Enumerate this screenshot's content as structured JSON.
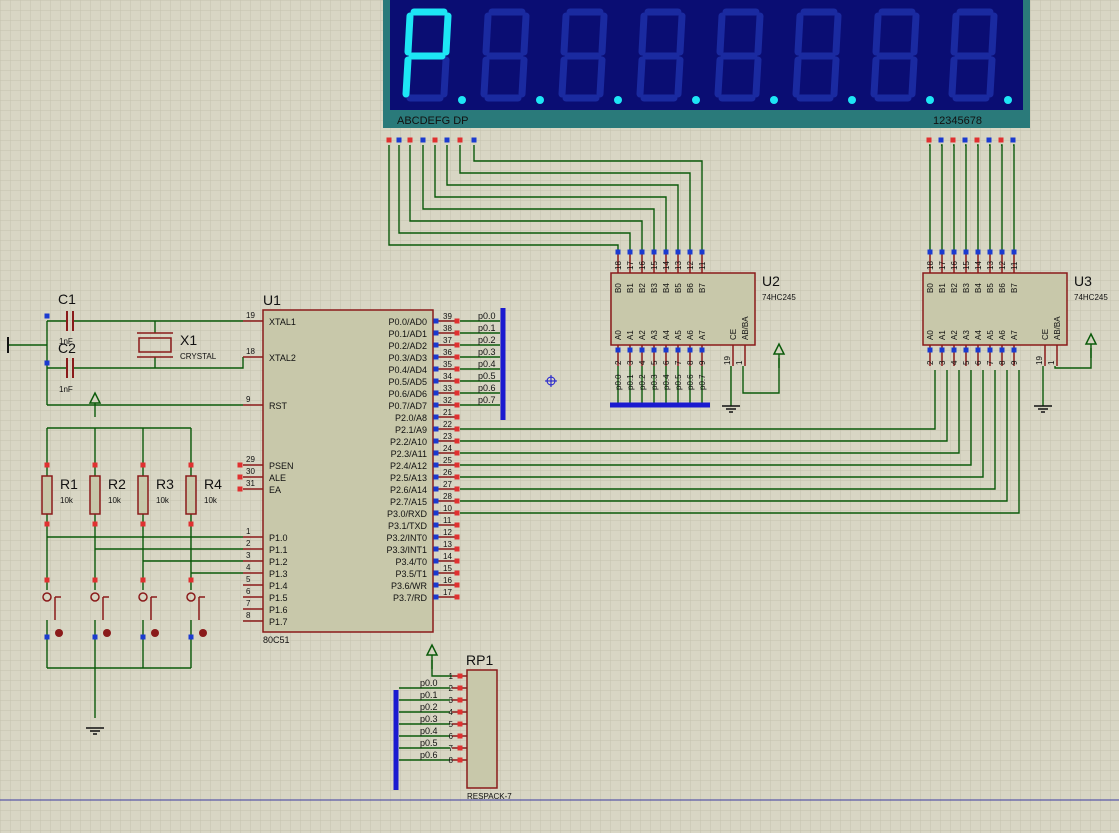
{
  "display": {
    "digit_text": "P",
    "seg_label": "ABCDEFG DP",
    "dig_label": "12345678",
    "colors": {
      "frame": "#2a7a7a",
      "background": "#0a0d73",
      "segment_on": "#1de6f5",
      "segment_off": "#1a2aa0"
    }
  },
  "u1": {
    "ref": "U1",
    "part": "80C51",
    "left_pins": [
      {
        "num": "19",
        "name": "XTAL1"
      },
      {
        "num": "18",
        "name": "XTAL2"
      },
      {
        "num": "9",
        "name": "RST"
      },
      {
        "num": "29",
        "name": "PSEN"
      },
      {
        "num": "30",
        "name": "ALE"
      },
      {
        "num": "31",
        "name": "EA"
      },
      {
        "num": "1",
        "name": "P1.0"
      },
      {
        "num": "2",
        "name": "P1.1"
      },
      {
        "num": "3",
        "name": "P1.2"
      },
      {
        "num": "4",
        "name": "P1.3"
      },
      {
        "num": "5",
        "name": "P1.4"
      },
      {
        "num": "6",
        "name": "P1.5"
      },
      {
        "num": "7",
        "name": "P1.6"
      },
      {
        "num": "8",
        "name": "P1.7"
      }
    ],
    "right_pins": [
      {
        "num": "39",
        "name": "P0.0/AD0",
        "net": "p0.0"
      },
      {
        "num": "38",
        "name": "P0.1/AD1",
        "net": "p0.1"
      },
      {
        "num": "37",
        "name": "P0.2/AD2",
        "net": "p0.2"
      },
      {
        "num": "36",
        "name": "P0.3/AD3",
        "net": "p0.3"
      },
      {
        "num": "35",
        "name": "P0.4/AD4",
        "net": "p0.4"
      },
      {
        "num": "34",
        "name": "P0.5/AD5",
        "net": "p0.5"
      },
      {
        "num": "33",
        "name": "P0.6/AD6",
        "net": "p0.6"
      },
      {
        "num": "32",
        "name": "P0.7/AD7",
        "net": "p0.7"
      },
      {
        "num": "21",
        "name": "P2.0/A8",
        "net": ""
      },
      {
        "num": "22",
        "name": "P2.1/A9",
        "net": ""
      },
      {
        "num": "23",
        "name": "P2.2/A10",
        "net": ""
      },
      {
        "num": "24",
        "name": "P2.3/A11",
        "net": ""
      },
      {
        "num": "25",
        "name": "P2.4/A12",
        "net": ""
      },
      {
        "num": "26",
        "name": "P2.5/A13",
        "net": ""
      },
      {
        "num": "27",
        "name": "P2.6/A14",
        "net": ""
      },
      {
        "num": "28",
        "name": "P2.7/A15",
        "net": ""
      },
      {
        "num": "10",
        "name": "P3.0/RXD",
        "net": ""
      },
      {
        "num": "11",
        "name": "P3.1/TXD",
        "net": ""
      },
      {
        "num": "12",
        "name": "P3.2/INT0",
        "net": ""
      },
      {
        "num": "13",
        "name": "P3.3/INT1",
        "net": ""
      },
      {
        "num": "14",
        "name": "P3.4/T0",
        "net": ""
      },
      {
        "num": "15",
        "name": "P3.5/T1",
        "net": ""
      },
      {
        "num": "16",
        "name": "P3.6/WR",
        "net": ""
      },
      {
        "num": "17",
        "name": "P3.7/RD",
        "net": ""
      }
    ]
  },
  "u2": {
    "ref": "U2",
    "part": "74HC245",
    "b_pins": [
      {
        "num": "18",
        "name": "B0"
      },
      {
        "num": "17",
        "name": "B1"
      },
      {
        "num": "16",
        "name": "B2"
      },
      {
        "num": "15",
        "name": "B3"
      },
      {
        "num": "14",
        "name": "B4"
      },
      {
        "num": "13",
        "name": "B5"
      },
      {
        "num": "12",
        "name": "B6"
      },
      {
        "num": "11",
        "name": "B7"
      }
    ],
    "a_pins": [
      {
        "num": "2",
        "name": "A0",
        "net": "p0.0"
      },
      {
        "num": "3",
        "name": "A1",
        "net": "p0.1"
      },
      {
        "num": "4",
        "name": "A2",
        "net": "p0.2"
      },
      {
        "num": "5",
        "name": "A3",
        "net": "p0.3"
      },
      {
        "num": "6",
        "name": "A4",
        "net": "p0.4"
      },
      {
        "num": "7",
        "name": "A5",
        "net": "p0.5"
      },
      {
        "num": "8",
        "name": "A6",
        "net": "p0.6"
      },
      {
        "num": "9",
        "name": "A7",
        "net": "p0.7"
      }
    ],
    "ctrl": [
      {
        "num": "19",
        "name": "CE"
      },
      {
        "num": "1",
        "name": "AB/BA"
      }
    ]
  },
  "u3": {
    "ref": "U3",
    "part": "74HC245",
    "b_pins": [
      {
        "num": "18",
        "name": "B0"
      },
      {
        "num": "17",
        "name": "B1"
      },
      {
        "num": "16",
        "name": "B2"
      },
      {
        "num": "15",
        "name": "B3"
      },
      {
        "num": "14",
        "name": "B4"
      },
      {
        "num": "13",
        "name": "B5"
      },
      {
        "num": "12",
        "name": "B6"
      },
      {
        "num": "11",
        "name": "B7"
      }
    ],
    "a_pins": [
      {
        "num": "2",
        "name": "A0"
      },
      {
        "num": "3",
        "name": "A1"
      },
      {
        "num": "4",
        "name": "A2"
      },
      {
        "num": "5",
        "name": "A3"
      },
      {
        "num": "6",
        "name": "A4"
      },
      {
        "num": "7",
        "name": "A5"
      },
      {
        "num": "8",
        "name": "A6"
      },
      {
        "num": "9",
        "name": "A7"
      }
    ],
    "ctrl": [
      {
        "num": "19",
        "name": "CE"
      },
      {
        "num": "1",
        "name": "AB/BA"
      }
    ]
  },
  "rp1": {
    "ref": "RP1",
    "part": "RESPACK-7",
    "pins": [
      {
        "num": "1",
        "net": ""
      },
      {
        "num": "2",
        "net": "p0.0"
      },
      {
        "num": "3",
        "net": "p0.1"
      },
      {
        "num": "4",
        "net": "p0.2"
      },
      {
        "num": "5",
        "net": "p0.3"
      },
      {
        "num": "6",
        "net": "p0.4"
      },
      {
        "num": "7",
        "net": "p0.5"
      },
      {
        "num": "8",
        "net": "p0.6"
      }
    ]
  },
  "passives": {
    "c1": {
      "ref": "C1",
      "value": "1nF"
    },
    "c2": {
      "ref": "C2",
      "value": "1nF"
    },
    "x1": {
      "ref": "X1",
      "value": "CRYSTAL"
    },
    "resistors": [
      {
        "ref": "R1",
        "value": "10k"
      },
      {
        "ref": "R2",
        "value": "10k"
      },
      {
        "ref": "R3",
        "value": "10k"
      },
      {
        "ref": "R4",
        "value": "10k"
      }
    ]
  }
}
